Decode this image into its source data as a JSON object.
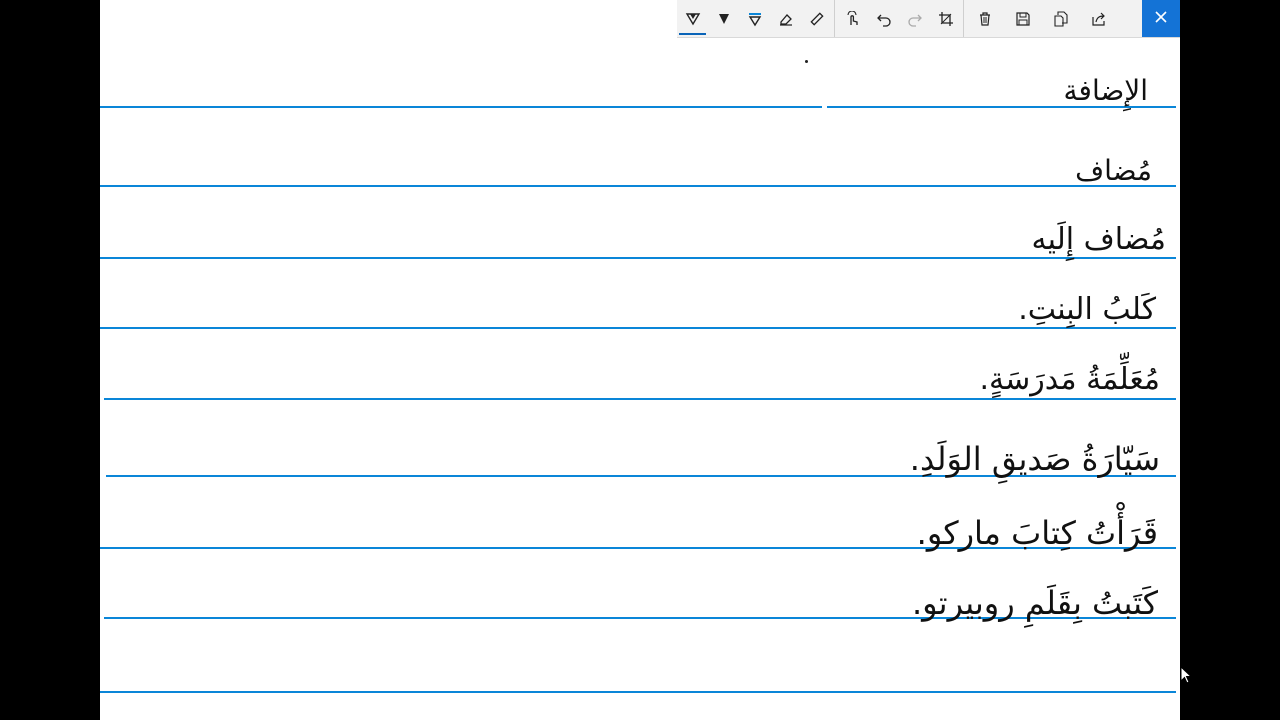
{
  "toolbar": {
    "tools": [
      {
        "icon": "ballpoint-pen-icon"
      },
      {
        "icon": "pencil-icon"
      },
      {
        "icon": "highlighter-icon"
      },
      {
        "icon": "eraser-icon"
      },
      {
        "icon": "ruler-icon"
      },
      {
        "icon": "touch-writing-icon"
      },
      {
        "icon": "undo-icon"
      },
      {
        "icon": "redo-icon"
      },
      {
        "icon": "crop-icon"
      },
      {
        "icon": "delete-icon"
      },
      {
        "icon": "save-icon"
      },
      {
        "icon": "copy-icon"
      },
      {
        "icon": "share-icon"
      },
      {
        "icon": "close-icon"
      }
    ],
    "accent_color": "#1473d6"
  },
  "notes": {
    "lines": [
      "الإِضافة",
      "مُضاف",
      "مُضاف إِلَيه",
      "كَلبُ البِنتِ.",
      "مُعَلِّمَةُ مَدرَسَةٍ.",
      "سَيّارَةُ صَديقِ الوَلَدِ.",
      "قَرَأْتُ كِتابَ ماركو.",
      "كَتَبتُ بِقَلَمِ روبيرتو."
    ],
    "rule_color": "#0a86d8"
  }
}
